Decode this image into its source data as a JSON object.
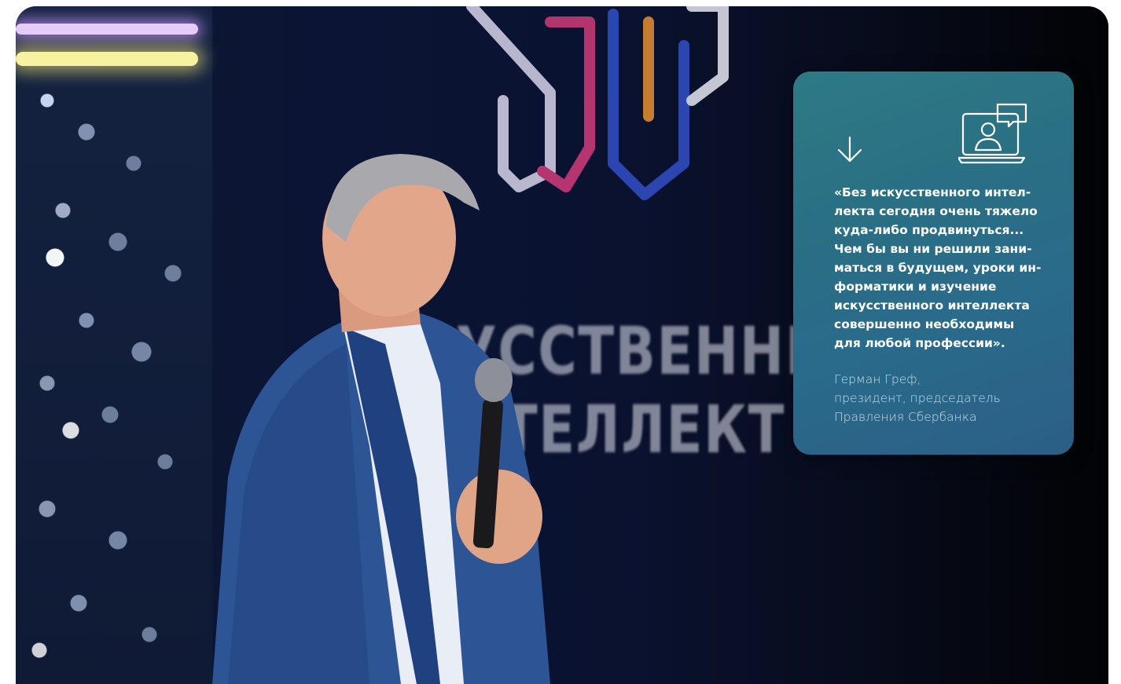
{
  "hero": {
    "background_text": {
      "line1": "УССТВЕННЫЙ",
      "line2": "НТЕЛЛЕКТ"
    },
    "colors": {
      "card_start": "#2e7a86",
      "card_end": "#2b5f86",
      "text": "#ffffff"
    }
  },
  "quote_card": {
    "arrow_icon": "arrow-down-icon",
    "illustration_icon": "presenter-on-screen-icon",
    "quote": "«Без искусственного интел-\nлекта сегодня очень тяжело\nкуда-либо продвинуться...\nЧем бы вы ни решили зани-\nматься в будущем, уроки ин-\nформатики и изучение\nискусственного интеллекта\nсовершенно необходимы\nдля любой профессии».",
    "author": "Герман Греф,\nпрезидент, председатель\nПравления Сбербанка"
  }
}
